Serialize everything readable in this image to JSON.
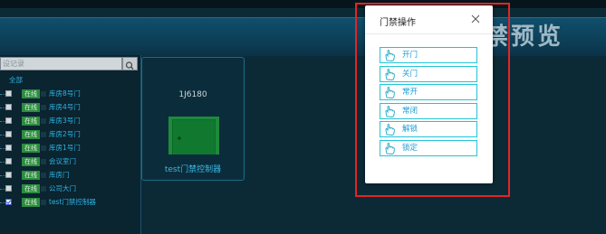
{
  "banner": {
    "title_fragment": "禁预览"
  },
  "sidebar": {
    "search_placeholder": "设记录",
    "root_label": "全部",
    "items": [
      {
        "status": "在线",
        "name": "库房8号门"
      },
      {
        "status": "在线",
        "name": "库房4号门"
      },
      {
        "status": "在线",
        "name": "库房3号门"
      },
      {
        "status": "在线",
        "name": "库房2号门"
      },
      {
        "status": "在线",
        "name": "库房1号门"
      },
      {
        "status": "在线",
        "name": "会议室门"
      },
      {
        "status": "在线",
        "name": "库房门"
      },
      {
        "status": "在线",
        "name": "公司大门"
      },
      {
        "status": "在线",
        "name": "test门禁控制器"
      }
    ]
  },
  "device": {
    "id": "1J6180",
    "name": "test门禁控制器",
    "door_color": "#1e8a3c"
  },
  "dialog": {
    "title": "门禁操作",
    "actions": [
      "开门",
      "关门",
      "常开",
      "常闭",
      "解锁",
      "锁定"
    ]
  },
  "colors": {
    "accent": "#22c4d6",
    "highlight": "#e32424",
    "online": "#2d8c3f"
  }
}
